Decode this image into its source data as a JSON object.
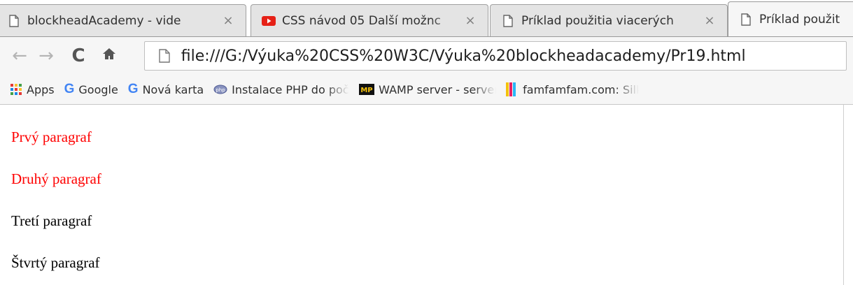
{
  "tabs": [
    {
      "label": "blockheadAcademy - vide",
      "icon": "page-icon",
      "close": "×"
    },
    {
      "label": "CSS návod 05 Další možnc",
      "icon": "youtube-icon",
      "close": "×"
    },
    {
      "label": "Príklad použitia viacerých",
      "icon": "page-icon",
      "close": "×"
    },
    {
      "label": "Príklad použit",
      "icon": "page-icon",
      "active": true
    }
  ],
  "toolbar": {
    "back": "←",
    "forward": "→",
    "reload": "C",
    "home": "⌂",
    "url": "file:///G:/Výuka%20CSS%20W3C/Výuka%20blockheadacademy/Pr19.html"
  },
  "bookmarks": [
    {
      "label": "Apps",
      "icon": "apps-grid-icon"
    },
    {
      "label": "Google",
      "icon": "google-g-icon"
    },
    {
      "label": "Nová karta",
      "icon": "google-g-icon"
    },
    {
      "label": "Instalace PHP do počí",
      "icon": "php-icon"
    },
    {
      "label": "WAMP server - server",
      "icon": "mp-icon"
    },
    {
      "label": "famfamfam.com: Silk I",
      "icon": "famfamfam-icon"
    }
  ],
  "page": {
    "paragraphs": [
      {
        "text": "Prvý paragraf",
        "color": "#ff0000"
      },
      {
        "text": "Druhý paragraf",
        "color": "#ff0000"
      },
      {
        "text": "Tretí paragraf",
        "color": "#000000"
      },
      {
        "text": "Štvrtý paragraf",
        "color": "#000000"
      }
    ]
  }
}
